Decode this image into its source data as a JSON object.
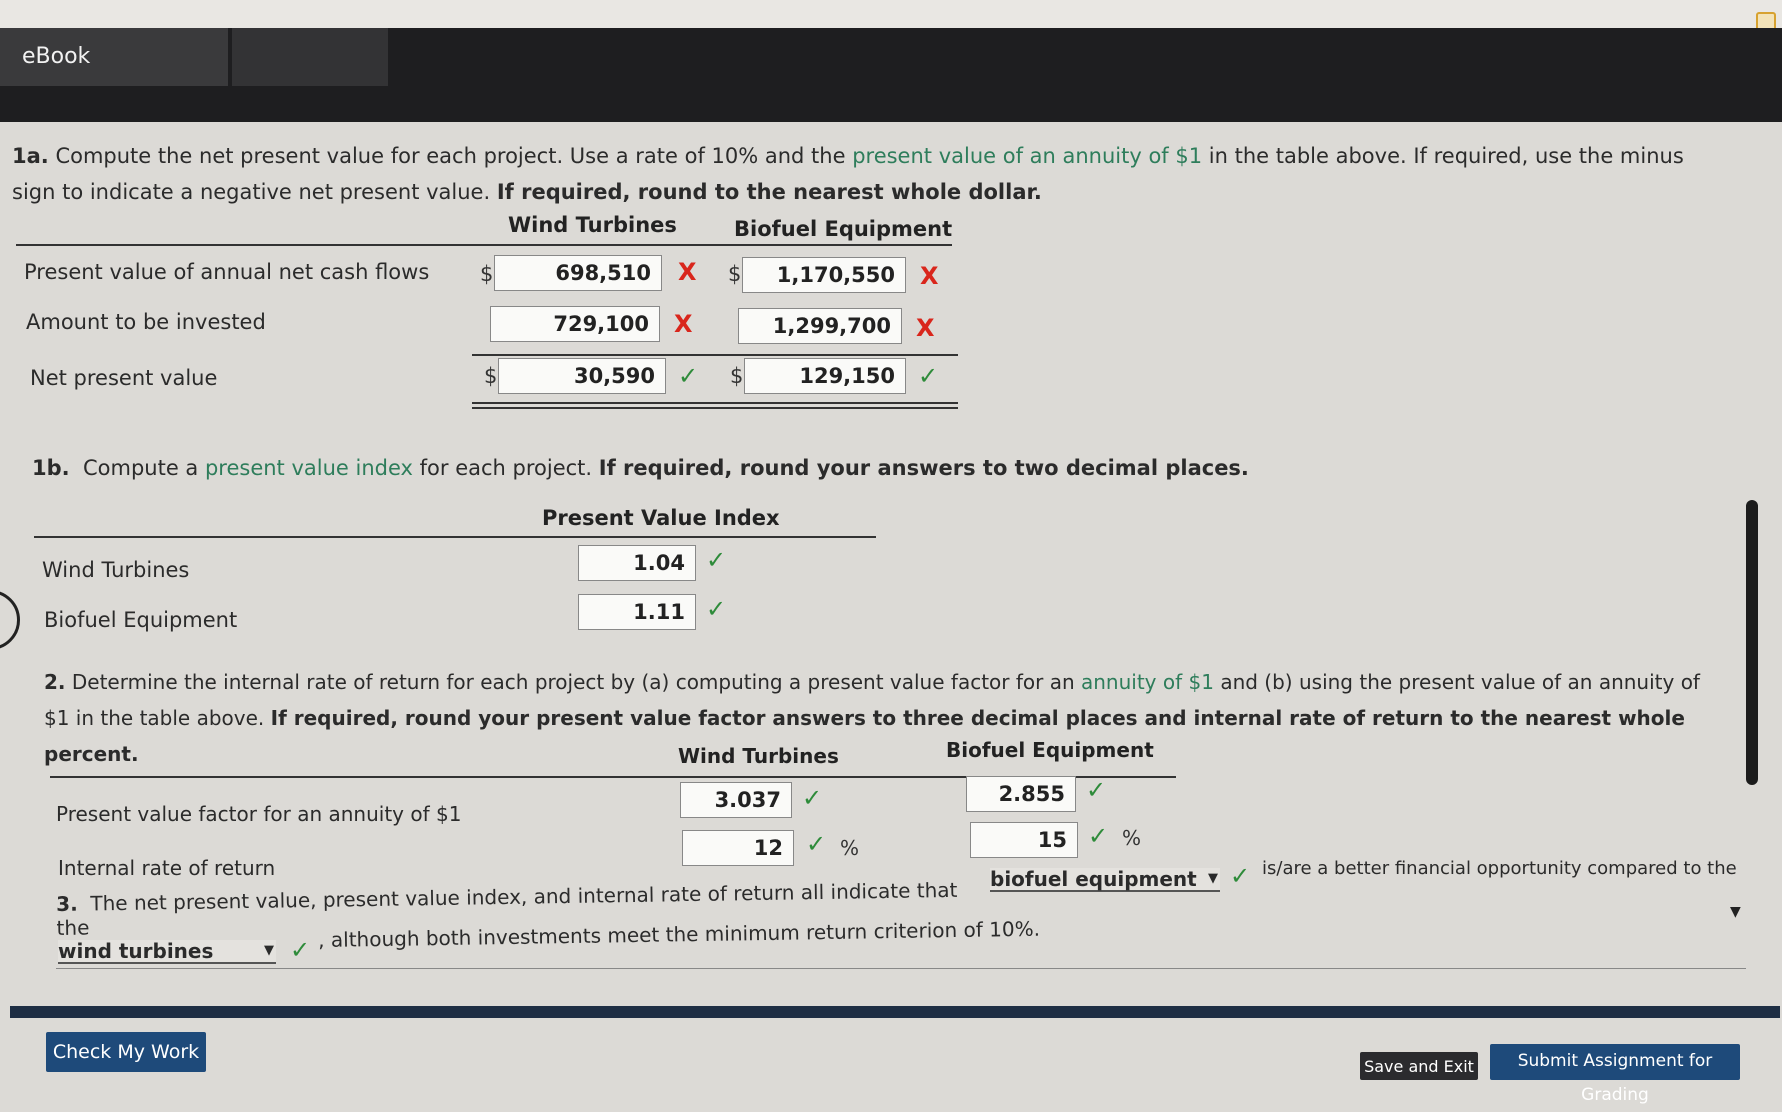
{
  "header": {
    "tab_label": "eBook"
  },
  "q1a": {
    "label": "1a.",
    "text_1": "Compute the net present value for each project. Use a rate of 10% and the ",
    "link": "present value of an annuity of $1",
    "text_2": " in the table above. If required, use the minus sign to indicate a negative net present value. ",
    "bold": "If required, round to the nearest whole dollar.",
    "col_wind": "Wind Turbines",
    "col_bio": "Biofuel Equipment",
    "rows": [
      {
        "label": "Present value of annual net cash flows",
        "wind": "698,510",
        "wind_mark": "X",
        "bio": "1,170,550",
        "bio_mark": "X",
        "dollar": "$"
      },
      {
        "label": "Amount to be invested",
        "wind": "729,100",
        "wind_mark": "X",
        "bio": "1,299,700",
        "bio_mark": "X"
      },
      {
        "label": "Net present value",
        "wind": "30,590",
        "wind_mark": "✓",
        "bio": "129,150",
        "bio_mark": "✓",
        "dollar": "$"
      }
    ]
  },
  "q1b": {
    "label": "1b.",
    "text_1": "Compute a ",
    "link": "present value index",
    "text_2": " for each project. ",
    "bold": "If required, round your answers to two decimal places.",
    "col": "Present Value Index",
    "rows": [
      {
        "label": "Wind Turbines",
        "value": "1.04",
        "mark": "✓"
      },
      {
        "label": "Biofuel Equipment",
        "value": "1.11",
        "mark": "✓"
      }
    ]
  },
  "q2": {
    "label": "2.",
    "text_1": "Determine the internal rate of return for each project by (a) computing a present value factor for an ",
    "link": "annuity of $1",
    "text_2": " and (b) using the present value of an annuity of $1 in the table above. ",
    "bold": "If required, round your present value factor answers to three decimal places and internal rate of return to the nearest whole percent.",
    "col_wind": "Wind Turbines",
    "col_bio": "Biofuel Equipment",
    "rows": [
      {
        "label": "Present value factor for an annuity of $1",
        "wind": "3.037",
        "bio": "2.855",
        "mark": "✓"
      },
      {
        "label": "Internal rate of return",
        "wind": "12",
        "bio": "15",
        "mark": "✓",
        "unit": "%"
      }
    ]
  },
  "q3": {
    "label": "3.",
    "text_1": "The net present value, present value index, and internal rate of return all indicate that the",
    "select_1": "biofuel equipment",
    "text_2": "is/are a better financial opportunity compared to the",
    "select_2": "wind turbines",
    "text_3": ", although both investments meet the minimum return criterion of 10%.",
    "mark": "✓"
  },
  "buttons": {
    "check": "Check My Work",
    "save": "Save and Exit",
    "submit": "Submit Assignment for Grading"
  },
  "colors": {
    "correct": "#2e8b3a",
    "incorrect": "#d9261c",
    "link": "#2e7d5b",
    "button": "#1e4a7a"
  }
}
